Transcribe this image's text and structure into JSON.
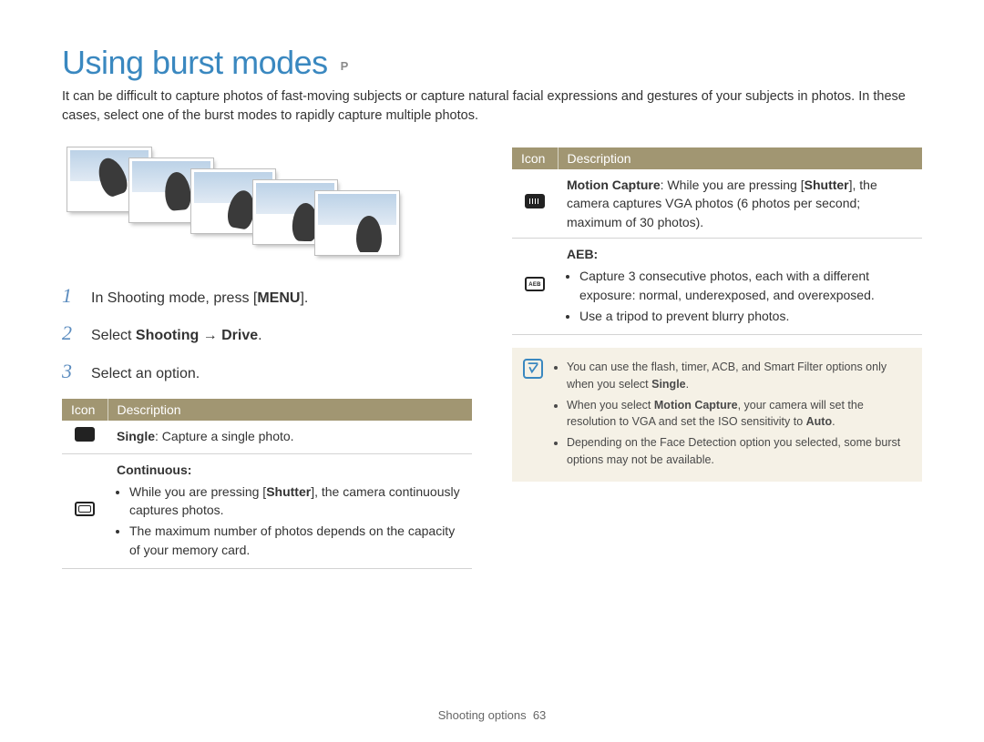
{
  "title": "Using burst modes",
  "mode_badge": "P",
  "intro": "It can be difficult to capture photos of fast-moving subjects or capture natural facial expressions and gestures of your subjects in photos. In these cases, select one of the burst modes to rapidly capture multiple photos.",
  "steps": [
    {
      "num": "1",
      "pre": "In Shooting mode, press [",
      "bold": "MENU",
      "post": "]."
    },
    {
      "num": "2",
      "pre": "Select ",
      "bold": "Shooting → Drive",
      "post": "."
    },
    {
      "num": "3",
      "pre": "Select an option.",
      "bold": "",
      "post": ""
    }
  ],
  "table_headers": {
    "icon": "Icon",
    "desc": "Description"
  },
  "left_rows": {
    "single": {
      "bold": "Single",
      "rest": ": Capture a single photo."
    },
    "continuous": {
      "title": "Continuous:",
      "bullets": [
        {
          "pre": "While you are pressing [",
          "bold": "Shutter",
          "post": "], the camera continuously captures photos."
        },
        {
          "pre": "The maximum number of photos depends on the capacity of your memory card.",
          "bold": "",
          "post": ""
        }
      ]
    }
  },
  "right_rows": {
    "motion": {
      "lead_bold": "Motion Capture",
      "mid": ": While you are pressing [",
      "mid_bold": "Shutter",
      "tail": "], the camera captures VGA photos (6 photos per second; maximum of 30 photos)."
    },
    "aeb": {
      "title": "AEB:",
      "bullets": [
        "Capture 3 consecutive photos, each with a different exposure: normal, underexposed, and overexposed.",
        "Use a tripod to prevent blurry photos."
      ]
    }
  },
  "notes": [
    {
      "pre": "You can use the flash, timer, ACB, and Smart Filter options only when you select ",
      "bold": "Single",
      "post": "."
    },
    {
      "pre": "When you select ",
      "bold": "Motion Capture",
      "post": ", your camera will set the resolution to VGA and set the ISO sensitivity to ",
      "bold2": "Auto",
      "post2": "."
    },
    {
      "pre": "Depending on the Face Detection option you selected, some burst options may not be available.",
      "bold": "",
      "post": ""
    }
  ],
  "footer": {
    "section": "Shooting options",
    "page": "63"
  }
}
